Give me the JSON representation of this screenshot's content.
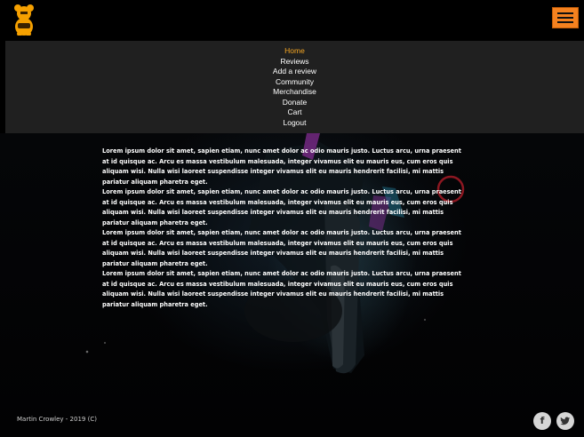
{
  "header": {
    "logo_icon": "bear-mascot-icon",
    "menu_icon": "hamburger-menu-icon",
    "accent_color": "#f5821f"
  },
  "nav": {
    "items": [
      {
        "label": "Home",
        "active": true
      },
      {
        "label": "Reviews",
        "active": false
      },
      {
        "label": "Add a review",
        "active": false
      },
      {
        "label": "Community",
        "active": false
      },
      {
        "label": "Merchandise",
        "active": false
      },
      {
        "label": "Donate",
        "active": false
      },
      {
        "label": "Cart",
        "active": false
      },
      {
        "label": "Logout",
        "active": false
      }
    ],
    "active_color": "#f5a623"
  },
  "main": {
    "paragraphs": [
      "Lorem ipsum dolor sit amet, sapien etiam, nunc amet dolor ac odio mauris justo. Luctus arcu, urna praesent at id quisque ac. Arcu es massa vestibulum malesuada, integer vivamus elit eu mauris eus, cum eros quis aliquam wisi. Nulla wisi laoreet suspendisse integer vivamus elit eu mauris hendrerit facilisi, mi mattis pariatur aliquam pharetra eget.",
      "Lorem ipsum dolor sit amet, sapien etiam, nunc amet dolor ac odio mauris justo. Luctus arcu, urna praesent at id quisque ac. Arcu es massa vestibulum malesuada, integer vivamus elit eu mauris eus, cum eros quis aliquam wisi. Nulla wisi laoreet suspendisse integer vivamus elit eu mauris hendrerit facilisi, mi mattis pariatur aliquam pharetra eget.",
      "Lorem ipsum dolor sit amet, sapien etiam, nunc amet dolor ac odio mauris justo. Luctus arcu, urna praesent at id quisque ac. Arcu es massa vestibulum malesuada, integer vivamus elit eu mauris eus, cum eros quis aliquam wisi. Nulla wisi laoreet suspendisse integer vivamus elit eu mauris hendrerit facilisi, mi mattis pariatur aliquam pharetra eget.",
      "Lorem ipsum dolor sit amet, sapien etiam, nunc amet dolor ac odio mauris justo. Luctus arcu, urna praesent at id quisque ac. Arcu es massa vestibulum malesuada, integer vivamus elit eu mauris eus, cum eros quis aliquam wisi. Nulla wisi laoreet suspendisse integer vivamus elit eu mauris hendrerit facilisi, mi mattis pariatur aliquam pharetra eget."
    ]
  },
  "footer": {
    "copyright": "Martin Crowley - 2019 (C)",
    "social": [
      {
        "icon": "facebook-icon",
        "glyph": "f"
      },
      {
        "icon": "twitter-icon",
        "glyph": "t"
      }
    ]
  }
}
